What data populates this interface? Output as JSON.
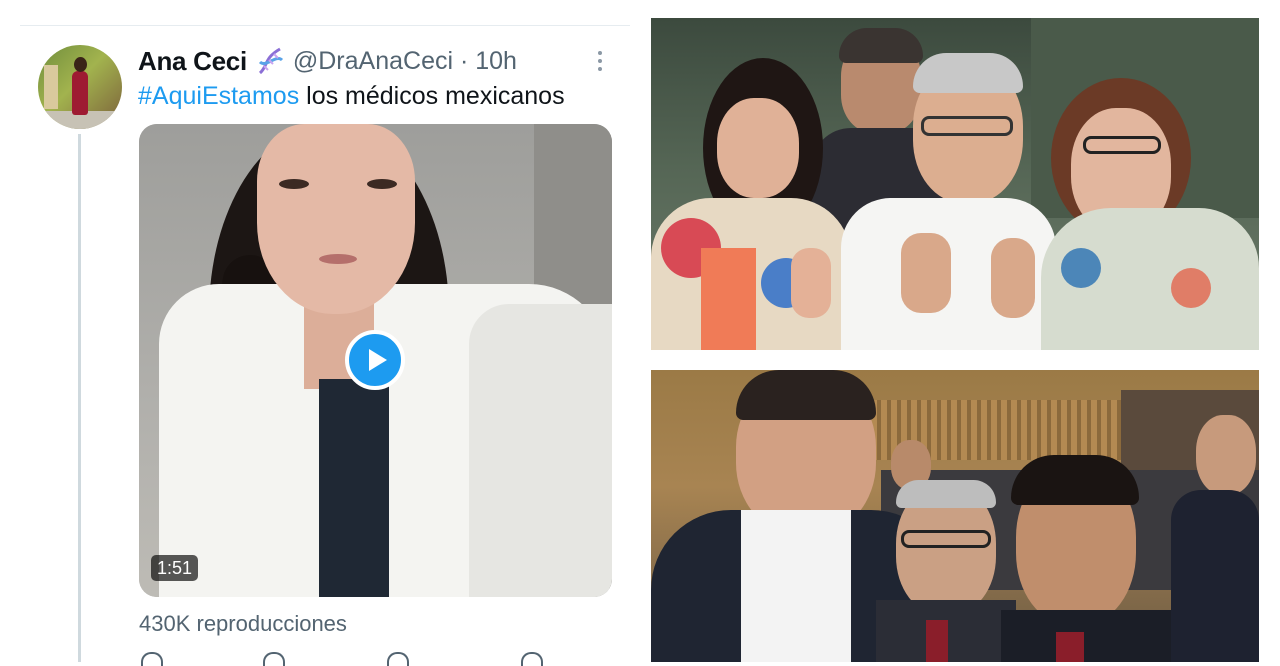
{
  "tweet": {
    "name": "Ana Ceci",
    "handle_time": "@DraAnaCeci · 10h",
    "hashtag": "#AquiEstamos",
    "body": " los médicos mexicanos",
    "video_duration": "1:51",
    "views": "430K reproducciones",
    "icons": [
      "dna-emoji",
      "more-icon",
      "play-icon",
      "reply-icon",
      "retweet-icon",
      "like-icon",
      "share-icon"
    ]
  },
  "colors": {
    "link": "#1d9bf0",
    "secondary_text": "#536471",
    "primary_text": "#0f1419",
    "thread_line": "#cfd9de"
  }
}
